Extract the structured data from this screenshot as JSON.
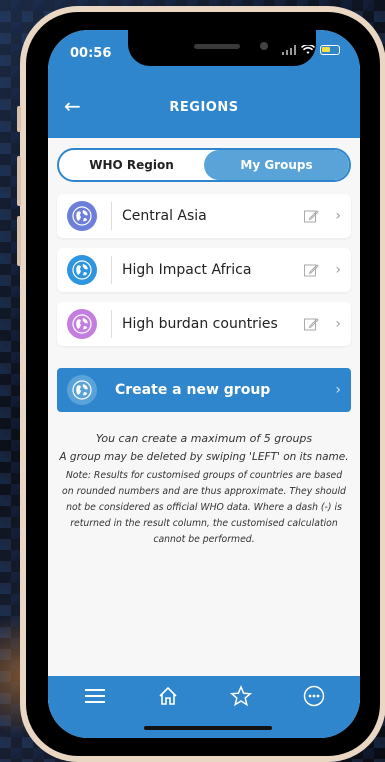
{
  "status": {
    "time": "00:56"
  },
  "header": {
    "title": "REGIONS"
  },
  "tabs": [
    {
      "label": "WHO Region",
      "active": false
    },
    {
      "label": "My Groups",
      "active": true
    }
  ],
  "groups": [
    {
      "name": "Central Asia",
      "icon_color": "#6d7fd8"
    },
    {
      "name": "High Impact Africa",
      "icon_color": "#2f95e0"
    },
    {
      "name": "High burdan countries",
      "icon_color": "#c27fe0"
    }
  ],
  "create_button": {
    "label": "Create a new group"
  },
  "info": {
    "line1": "You can create a maximum of 5 groups",
    "line2": "A group may be deleted by swiping 'LEFT' on its name.",
    "note": "Note: Results for customised groups of countries are based on rounded numbers and are thus approximate. They should not be considered as official WHO data. Where a dash (-) is returned in the result column, the customised calculation cannot be performed."
  },
  "colors": {
    "primary": "#2f86cc",
    "tab_active": "#5aa3d8"
  },
  "icons": {
    "back": "back-arrow-icon",
    "edit": "edit-icon",
    "chevron": "chevron-right-icon",
    "nav": [
      "menu-icon",
      "home-icon",
      "star-icon",
      "more-icon"
    ]
  }
}
